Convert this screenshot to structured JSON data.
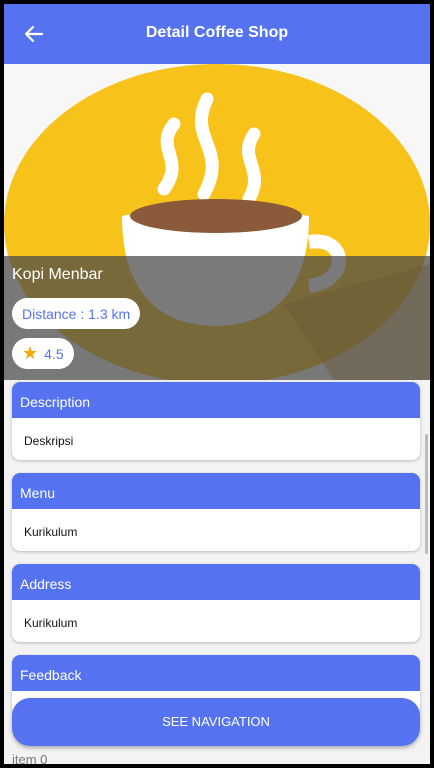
{
  "app": {
    "title": "Detail Coffee Shop"
  },
  "shop": {
    "name": "Kopi Menbar",
    "distance": "Distance : 1.3 km",
    "rating": "4.5"
  },
  "sections": [
    {
      "title": "Description",
      "content": "Deskripsi"
    },
    {
      "title": "Menu",
      "content": "Kurikulum"
    },
    {
      "title": "Address",
      "content": "Kurikulum"
    },
    {
      "title": "Feedback"
    }
  ],
  "navigation_button": "SEE NAVIGATION",
  "list_item": "item 0",
  "colors": {
    "primary": "#5573f0",
    "banner_yellow": "#f7c21a",
    "star": "#f2a900"
  },
  "icons": {
    "back": "arrow-left-icon",
    "star": "star-icon",
    "image": "coffee-cup-icon"
  }
}
